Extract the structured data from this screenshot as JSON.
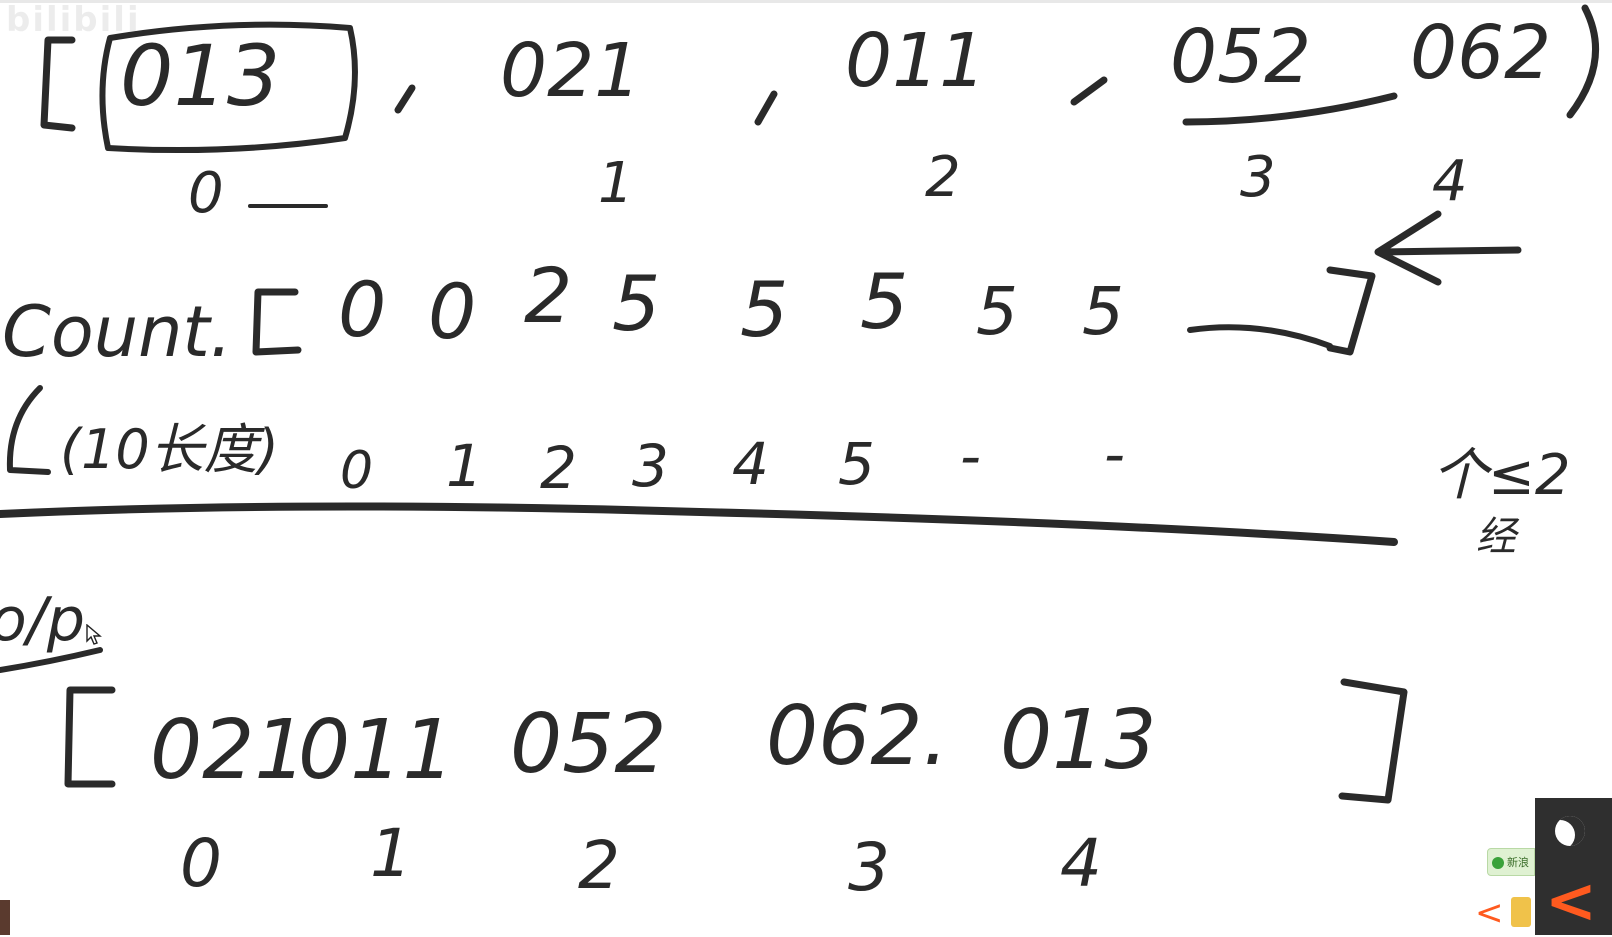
{
  "watermark": "bilibili",
  "row1": {
    "items": [
      "013",
      "021",
      "011",
      "052",
      "062"
    ],
    "indices": [
      "0",
      "1",
      "2",
      "3",
      "4"
    ]
  },
  "count": {
    "label": "Count.",
    "note": "(10长度)",
    "values": [
      "0",
      "0",
      "2",
      "5",
      "5",
      "5",
      "5",
      "5"
    ],
    "indices": [
      "0",
      "1",
      "2",
      "3",
      "4",
      "5",
      "-",
      "-"
    ]
  },
  "side_note": {
    "line1": "个≤2",
    "line2": "经"
  },
  "output": {
    "label": "o/p",
    "items": [
      "021",
      "011",
      "052",
      "062.",
      "013"
    ],
    "indices": [
      "0",
      "1",
      "2",
      "3",
      "4"
    ]
  },
  "overlay": {
    "notification_text": "新浪",
    "prev_arrow": "<",
    "pip_arrow": "<"
  },
  "colors": {
    "ink": "#2a2a2a",
    "accent": "#ff5a1f",
    "background": "#ffffff"
  }
}
